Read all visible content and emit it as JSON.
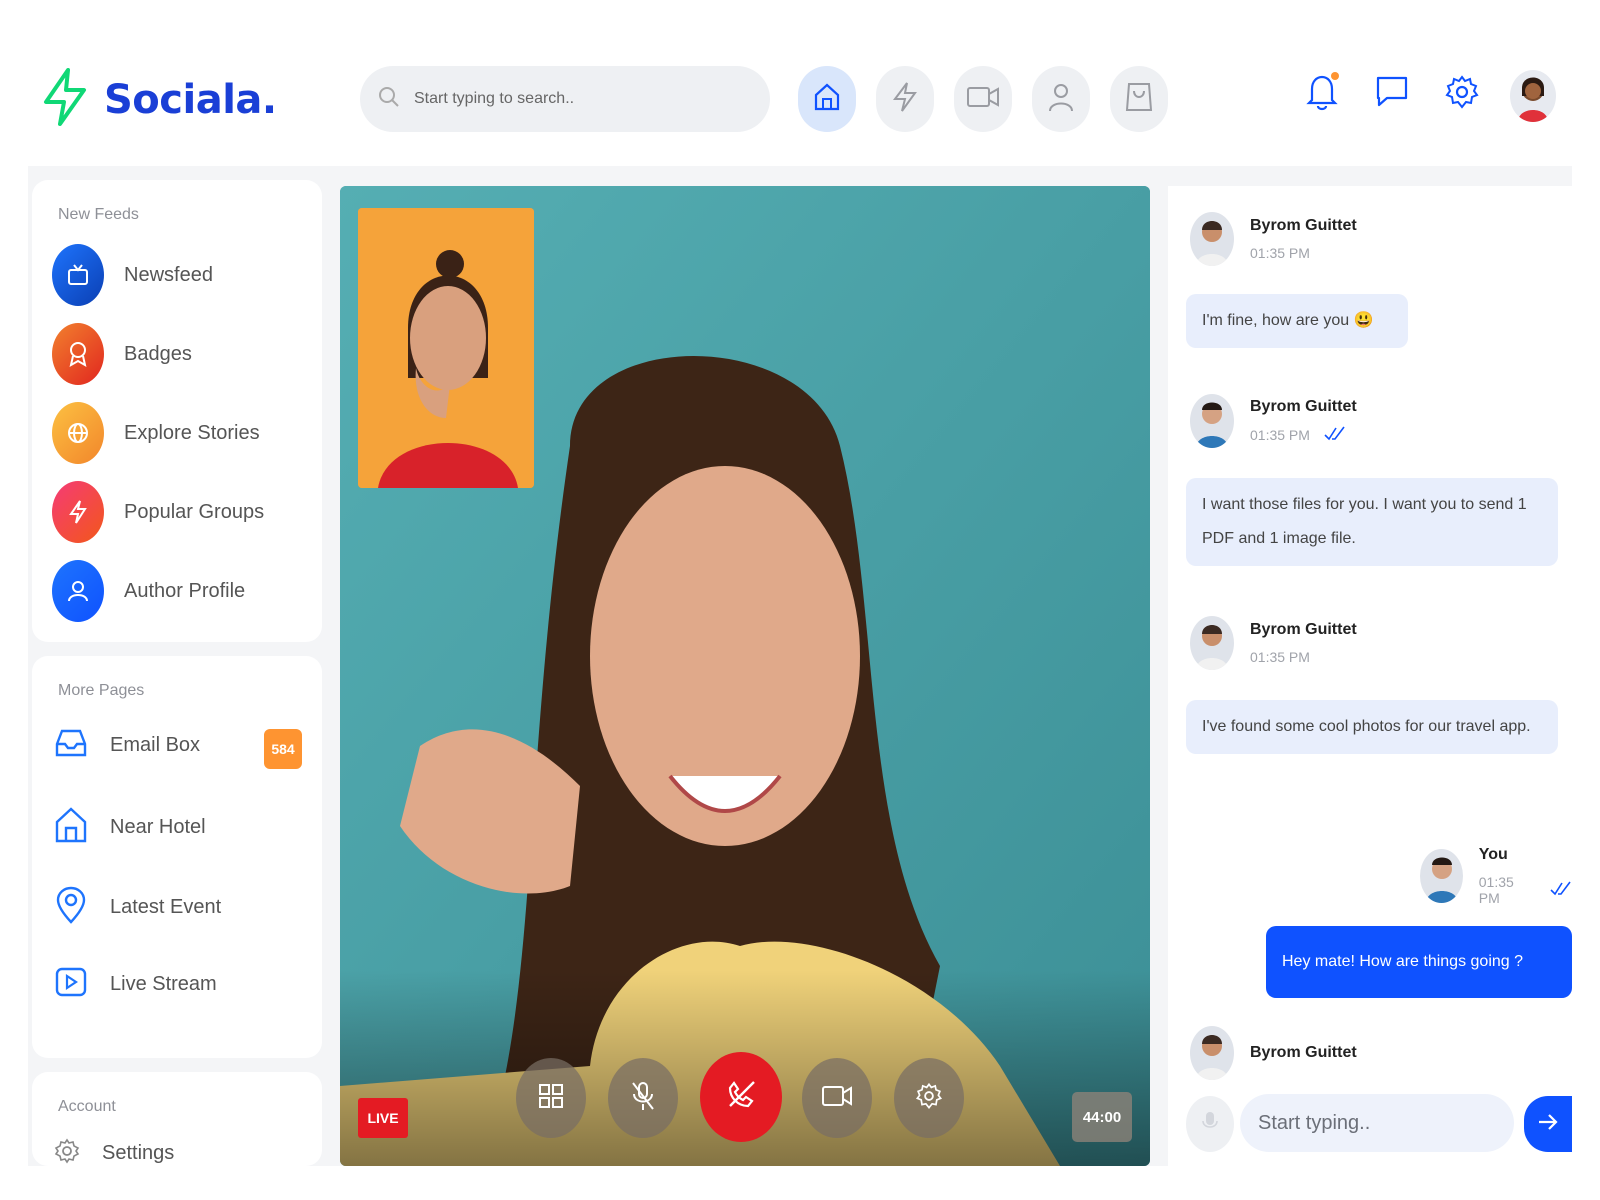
{
  "brand": {
    "name": "Sociala."
  },
  "search": {
    "placeholder": "Start typing to search.."
  },
  "nav": {
    "items": [
      {
        "icon": "home-icon",
        "active": true
      },
      {
        "icon": "lightning-icon",
        "active": false
      },
      {
        "icon": "video-icon",
        "active": false
      },
      {
        "icon": "user-icon",
        "active": false
      },
      {
        "icon": "shopping-bag-icon",
        "active": false
      }
    ]
  },
  "header_icons": [
    "bell-icon",
    "message-icon",
    "settings-icon",
    "user-avatar"
  ],
  "new_feeds": {
    "title": "New Feeds",
    "items": [
      {
        "label": "Newsfeed",
        "icon": "tv-icon",
        "color": "#0f52ff"
      },
      {
        "label": "Badges",
        "icon": "award-icon",
        "color": "#f64b16"
      },
      {
        "label": "Explore Stories",
        "icon": "globe-icon",
        "color": "#fdb22f"
      },
      {
        "label": "Popular Groups",
        "icon": "lightning-icon",
        "color": "#ee2b5b"
      },
      {
        "label": "Author Profile",
        "icon": "user-icon",
        "color": "#1e74fd"
      }
    ]
  },
  "more_pages": {
    "title": "More Pages",
    "items": [
      {
        "label": "Email Box",
        "icon": "inbox-icon",
        "badge": "584"
      },
      {
        "label": "Near Hotel",
        "icon": "home-icon"
      },
      {
        "label": "Latest Event",
        "icon": "map-pin-icon"
      },
      {
        "label": "Live Stream",
        "icon": "youtube-icon"
      }
    ]
  },
  "account": {
    "title": "Account",
    "items": [
      {
        "label": "Settings",
        "icon": "settings-icon"
      }
    ]
  },
  "video_call": {
    "live_label": "LIVE",
    "timer": "44:00",
    "controls": [
      "grid-icon",
      "mic-off-icon",
      "end-call-icon",
      "camera-icon",
      "settings-icon"
    ]
  },
  "chat": {
    "messages": [
      {
        "sender": "Byrom Guittet",
        "time": "01:35 PM",
        "text": "I'm fine, how are you 😃",
        "read": false
      },
      {
        "sender": "Byrom Guittet",
        "time": "01:35 PM",
        "text": "I want those files for you. I want you to send 1 PDF and 1 image file.",
        "read": true
      },
      {
        "sender": "Byrom Guittet",
        "time": "01:35 PM",
        "text": "I've found some cool photos for our travel app.",
        "read": false
      },
      {
        "sender": "You",
        "time": "01:35 PM",
        "text": "Hey mate! How are things going ?",
        "read": true
      },
      {
        "sender": "Byrom Guittet",
        "time": "01:35 PM",
        "text": "",
        "read": false
      }
    ],
    "input_placeholder": "Start typing.."
  },
  "colors": {
    "primary": "#0f52ff",
    "logo": "#1a3fd6",
    "accent_green": "#10d876",
    "live_red": "#e41b23",
    "badge_orange": "#fe9431"
  }
}
